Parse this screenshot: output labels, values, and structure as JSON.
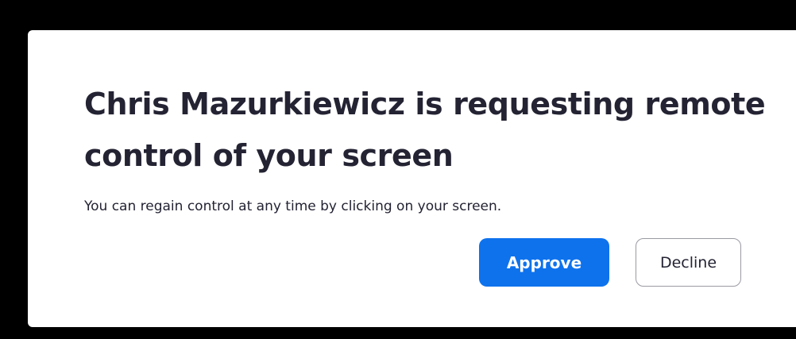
{
  "dialog": {
    "title": "Chris Mazurkiewicz is requesting remote control of your screen",
    "message": "You can regain control at any time by clicking on your screen.",
    "approve_label": "Approve",
    "decline_label": "Decline"
  },
  "colors": {
    "background": "#000000",
    "dialog_background": "#ffffff",
    "text": "#232333",
    "accent": "#0e72ed",
    "decline_border": "#9a9aa3"
  }
}
